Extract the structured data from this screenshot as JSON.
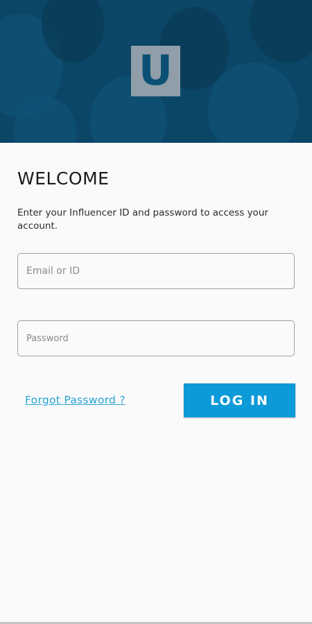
{
  "header": {
    "logo_letter": "U",
    "logo_color": "#0a4f74",
    "background_color": "#0c4666"
  },
  "login": {
    "title": "WELCOME",
    "subtitle": "Enter your Influencer ID and password to access your account.",
    "email_placeholder": "Email or ID",
    "email_value": "",
    "password_placeholder": "Password",
    "password_value": "",
    "forgot_label": "Forgot Password ?",
    "login_label": "LOG IN",
    "accent_color": "#0c9ad9",
    "link_color": "#29a3d4"
  }
}
